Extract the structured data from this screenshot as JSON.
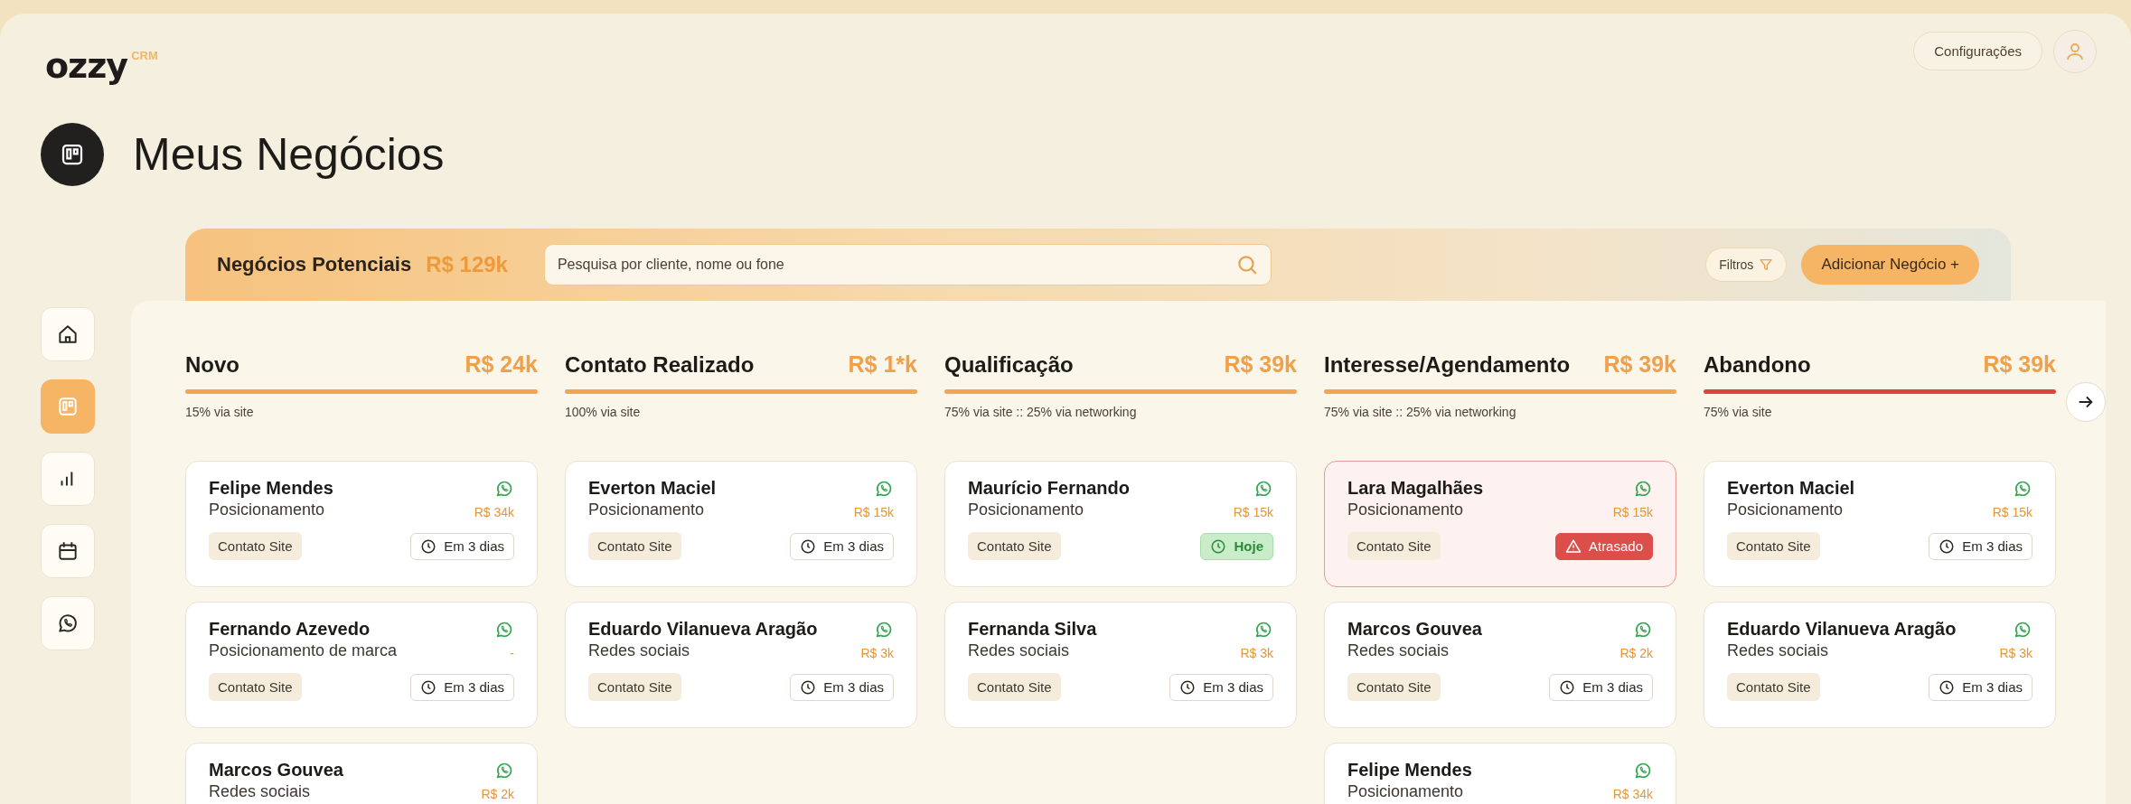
{
  "logo": {
    "name": "ozzy",
    "badge": "CRM"
  },
  "header": {
    "settings_button": "Configurações"
  },
  "page_title": "Meus Negócios",
  "sidebar": {
    "items": [
      {
        "selected": false
      },
      {
        "selected": true
      },
      {
        "selected": false
      },
      {
        "selected": false
      },
      {
        "selected": false
      }
    ]
  },
  "toolbar": {
    "title": "Negócios Potenciais",
    "total": "R$ 129k",
    "search": {
      "placeholder": "Pesquisa por cliente, nome ou fone"
    },
    "filter_button": "Filtros",
    "add_button": "Adicionar Negócio +"
  },
  "columns": [
    {
      "title": "Novo",
      "total": "R$ 24k",
      "color": "#f2a654",
      "source": "15% via site",
      "cards": [
        {
          "name": "Felipe Mendes",
          "subject": "Posicionamento",
          "value": "R$ 34k",
          "tag": "Contato Site",
          "due": {
            "kind": "days",
            "label": "Em 3 dias"
          }
        },
        {
          "name": "Fernando Azevedo",
          "subject": "Posicionamento de marca",
          "value": "-",
          "tag": "Contato Site",
          "due": {
            "kind": "days",
            "label": "Em 3 dias"
          }
        },
        {
          "name": "Marcos Gouvea",
          "subject": "Redes sociais",
          "value": "R$ 2k"
        }
      ]
    },
    {
      "title": "Contato Realizado",
      "total": "R$ 1*k",
      "color": "#f2a654",
      "source": "100% via site",
      "cards": [
        {
          "name": "Everton Maciel",
          "subject": "Posicionamento",
          "value": "R$ 15k",
          "tag": "Contato Site",
          "due": {
            "kind": "days",
            "label": "Em 3 dias"
          }
        },
        {
          "name": "Eduardo Vilanueva Aragão",
          "subject": "Redes sociais",
          "value": "R$ 3k",
          "tag": "Contato Site",
          "due": {
            "kind": "days",
            "label": "Em 3 dias"
          }
        }
      ]
    },
    {
      "title": "Qualificação",
      "total": "R$ 39k",
      "color": "#f2a654",
      "source": "75% via site :: 25% via networking",
      "cards": [
        {
          "name": "Maurício Fernando",
          "subject": "Posicionamento",
          "value": "R$ 15k",
          "tag": "Contato Site",
          "due": {
            "kind": "today",
            "label": "Hoje"
          }
        },
        {
          "name": "Fernanda Silva",
          "subject": "Redes sociais",
          "value": "R$ 3k",
          "tag": "Contato Site",
          "due": {
            "kind": "days",
            "label": "Em 3 dias"
          }
        }
      ]
    },
    {
      "title": "Interesse/Agendamento",
      "total": "R$ 39k",
      "color": "#f2a654",
      "source": "75% via site :: 25% via networking",
      "cards": [
        {
          "name": "Lara Magalhães",
          "subject": "Posicionamento",
          "value": "R$ 15k",
          "tag": "Contato Site",
          "due": {
            "kind": "late",
            "label": "Atrasado"
          }
        },
        {
          "name": "Marcos Gouvea",
          "subject": "Redes sociais",
          "value": "R$ 2k",
          "tag": "Contato Site",
          "due": {
            "kind": "days",
            "label": "Em 3 dias"
          }
        },
        {
          "name": "Felipe Mendes",
          "subject": "Posicionamento",
          "value": "R$ 34k"
        }
      ]
    },
    {
      "title": "Abandono",
      "total": "R$ 39k",
      "color": "#d9473f",
      "source": "75% via site",
      "cards": [
        {
          "name": "Everton Maciel",
          "subject": "Posicionamento",
          "value": "R$ 15k",
          "tag": "Contato Site",
          "due": {
            "kind": "days",
            "label": "Em 3 dias"
          }
        },
        {
          "name": "Eduardo Vilanueva Aragão",
          "subject": "Redes sociais",
          "value": "R$ 3k",
          "tag": "Contato Site",
          "due": {
            "kind": "days",
            "label": "Em 3 dias"
          }
        }
      ]
    }
  ]
}
